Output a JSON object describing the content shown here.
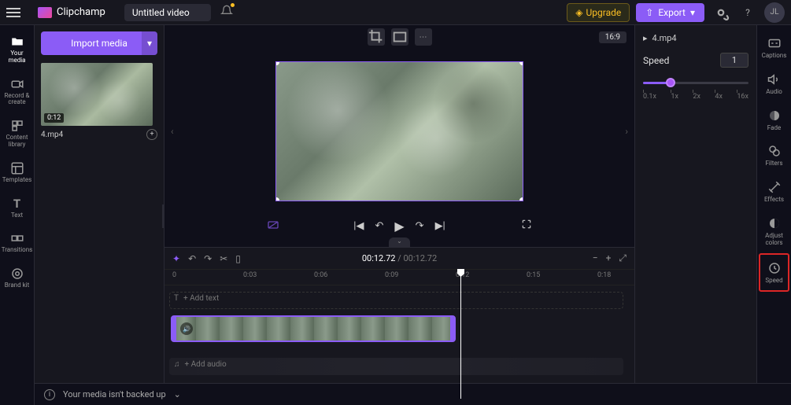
{
  "app": {
    "name": "Clipchamp",
    "title": "Untitled video"
  },
  "topbar": {
    "upgrade": "Upgrade",
    "export": "Export",
    "avatar": "JL"
  },
  "leftNav": [
    {
      "label": "Your media",
      "icon": "folder"
    },
    {
      "label": "Record & create",
      "icon": "camera"
    },
    {
      "label": "Content library",
      "icon": "library"
    },
    {
      "label": "Templates",
      "icon": "templates"
    },
    {
      "label": "Text",
      "icon": "text"
    },
    {
      "label": "Transitions",
      "icon": "transitions"
    },
    {
      "label": "Brand kit",
      "icon": "brand"
    }
  ],
  "mediaPanel": {
    "import": "Import media",
    "items": [
      {
        "name": "4.mp4",
        "duration": "0:12"
      }
    ]
  },
  "preview": {
    "aspect": "16:9"
  },
  "timeline": {
    "current": "00:12.72",
    "total": "00:12.72",
    "ticks": [
      "0",
      "0:03",
      "0:06",
      "0:09",
      "0:12",
      "0:15",
      "0:18"
    ],
    "addText": "+ Add text",
    "addAudio": "+ Add audio"
  },
  "speedPanel": {
    "file": "4.mp4",
    "title": "Speed",
    "value": "1",
    "marks": [
      "0.1x",
      "1x",
      "2x",
      "4x",
      "16x"
    ]
  },
  "rightNav": [
    {
      "label": "Captions"
    },
    {
      "label": "Audio"
    },
    {
      "label": "Fade"
    },
    {
      "label": "Filters"
    },
    {
      "label": "Effects"
    },
    {
      "label": "Adjust colors"
    },
    {
      "label": "Speed",
      "highlighted": true
    }
  ],
  "bottom": {
    "backup": "Your media isn't backed up"
  }
}
